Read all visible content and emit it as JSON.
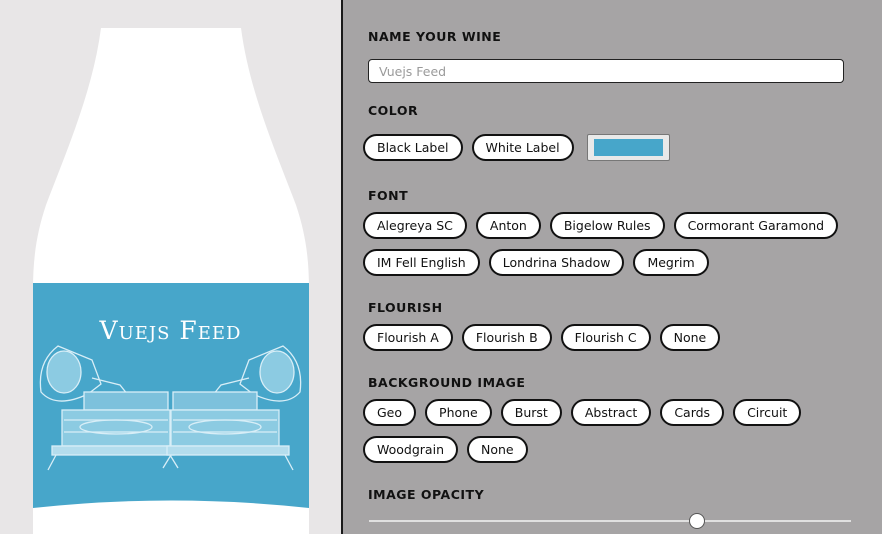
{
  "preview": {
    "wine_name": "Vuejs Feed",
    "label_color": "#47a6ca",
    "flourish_icon": "gramophone-icon"
  },
  "form": {
    "name": {
      "title": "NAME YOUR WINE",
      "placeholder": "Vuejs Feed",
      "value": ""
    },
    "color": {
      "title": "COLOR",
      "options": [
        "Black Label",
        "White Label"
      ],
      "swatch": "#47a6ca"
    },
    "font": {
      "title": "FONT",
      "options": [
        "Alegreya SC",
        "Anton",
        "Bigelow Rules",
        "Cormorant Garamond",
        "IM Fell English",
        "Londrina Shadow",
        "Megrim"
      ]
    },
    "flourish": {
      "title": "FLOURISH",
      "options": [
        "Flourish A",
        "Flourish B",
        "Flourish C",
        "None"
      ]
    },
    "background_image": {
      "title": "BACKGROUND IMAGE",
      "options": [
        "Geo",
        "Phone",
        "Burst",
        "Abstract",
        "Cards",
        "Circuit",
        "Woodgrain",
        "None"
      ]
    },
    "image_opacity": {
      "title": "IMAGE OPACITY",
      "value": 0.68
    }
  }
}
